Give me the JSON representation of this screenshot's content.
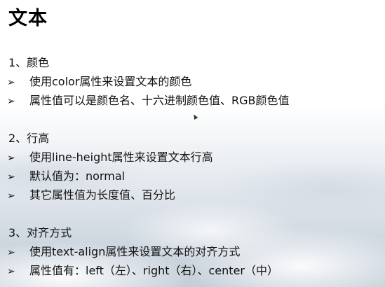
{
  "slide": {
    "title": "文本",
    "bullet_glyph": "➢",
    "sections": [
      {
        "heading": "1、颜色",
        "bullets": [
          "使用color属性来设置文本的颜色",
          "属性值可以是颜色名、十六进制颜色值、RGB颜色值"
        ]
      },
      {
        "heading": "2、行高",
        "bullets": [
          "使用line-height属性来设置文本行高",
          "默认值为：normal",
          "其它属性值为长度值、百分比"
        ]
      },
      {
        "heading": "3、对齐方式",
        "bullets": [
          "使用text-align属性来设置文本的对齐方式",
          "属性值有：left（左）、right（右）、center（中）"
        ]
      }
    ]
  }
}
